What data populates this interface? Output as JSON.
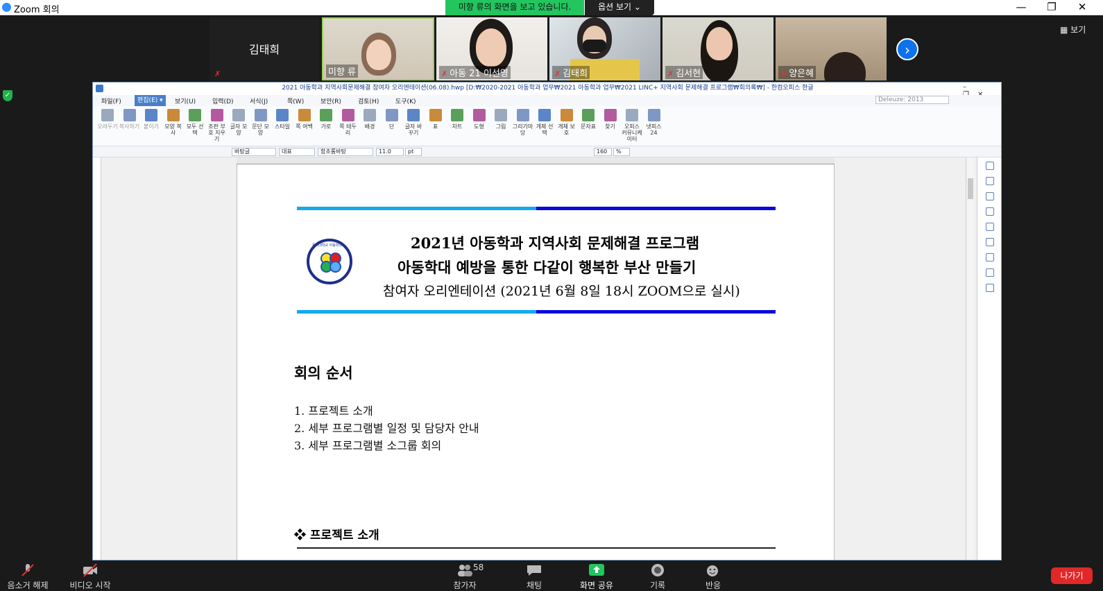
{
  "window": {
    "app_title": "Zoom 회의",
    "share_banner": "미향 류의 화면을 보고 있습니다.",
    "view_options": "옵션 보기 ⌄",
    "view_button": "보기"
  },
  "participants": [
    {
      "name": "김태희",
      "muted": true,
      "video": false
    },
    {
      "name": "미향 류",
      "muted": false,
      "video": true
    },
    {
      "name": "아동 21 이선영",
      "muted": true,
      "video": true
    },
    {
      "name": "김태희",
      "muted": true,
      "video": true
    },
    {
      "name": "김서현",
      "muted": true,
      "video": true
    },
    {
      "name": "양은혜",
      "muted": true,
      "video": true
    }
  ],
  "hwp": {
    "title": "2021 아동학과 지역사회문제해결 참여자 오리엔테이션(06.08).hwp [D:₩2020-2021 아동학과 업무₩2021 아동학과 업무₩2021 LINC+ 지역사회 문제해결 프로그램₩회의록₩] - 한컴오피스 한글",
    "menus": [
      "파일(F)",
      "편집(E)",
      "보기(U)",
      "입력(D)",
      "서식(J)",
      "쪽(W)",
      "보안(R)",
      "검토(H)",
      "도구(K)"
    ],
    "theme": "Deleuze: 2013",
    "ribbon": [
      "오려두기",
      "복사하기",
      "붙이기",
      "모양 복사",
      "모두 선택",
      "조판 부호 지우기",
      "글자 모양",
      "문단 모양",
      "스타일",
      "쪽 여백",
      "가로",
      "쪽 테두리",
      "배경",
      "단",
      "글자 바꾸기",
      "표",
      "차트",
      "도형",
      "그림",
      "그리기마당",
      "개체 선택",
      "개체 보호",
      "문자표",
      "찾기",
      "오피스 커뮤니케이터",
      "넷피스 24"
    ],
    "format": {
      "style": "바탕글",
      "lang": "대표",
      "font": "함초롬바탕",
      "size": "11.0",
      "unit": "pt",
      "zoom": "160",
      "zoom_unit": "%"
    }
  },
  "document": {
    "title1": "2021년 아동학과 지역사회 문제해결 프로그램",
    "title2": "아동학대 예방을 통한 다같이 행복한 부산 만들기",
    "title3": "참여자 오리엔테이션 (2021년 6월 8일 18시 ZOOM으로 실시)",
    "emblem_text": "동의대학교 아동학과",
    "section_heading": "회의 순서",
    "agenda": [
      "1. 프로젝트 소개",
      "2. 세부 프로그램별 일정 및 담당자 안내",
      "3. 세부 프로그램별 소그룹 회의"
    ],
    "subheading": "❖ 프로젝트 소개"
  },
  "toolbar": {
    "mute": "음소거 해제",
    "video": "비디오 시작",
    "participants": "참가자",
    "participant_count": "58",
    "chat": "채팅",
    "share": "화면 공유",
    "record": "기록",
    "reactions": "반응",
    "leave": "나가기"
  },
  "colors": {
    "share_green": "#22c55e",
    "leave_red": "#e02828",
    "bar_light": "#13a8f0",
    "bar_dark": "#0a0adc"
  }
}
